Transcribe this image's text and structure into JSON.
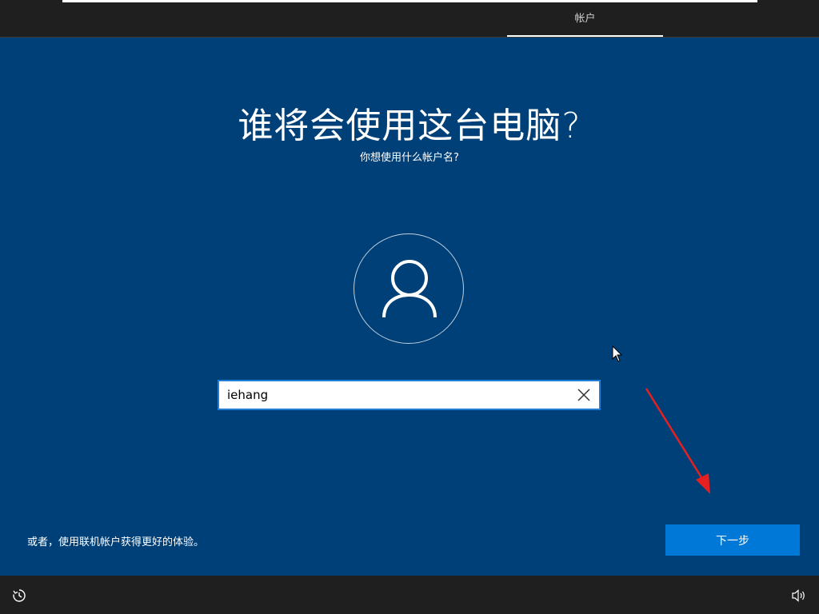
{
  "header": {
    "active_tab": "帐户"
  },
  "main": {
    "title": "谁将会使用这台电脑?",
    "subtitle": "你想使用什么帐户名?",
    "name_input": {
      "value": "iehang",
      "placeholder": ""
    },
    "online_account_link": "或者，使用联机帐户获得更好的体验。",
    "next_button_label": "下一步"
  },
  "icons": {
    "avatar": "user-icon",
    "clear": "close-icon",
    "ease_of_access": "ease-of-access-icon",
    "volume": "volume-icon",
    "mouse_cursor": "mouse-pointer-icon",
    "annotation": "red-arrow-icon"
  },
  "colors": {
    "background_blue": "#004078",
    "accent_blue": "#0078d7",
    "input_border": "#1f7fd6",
    "bar_dark": "#1f1f1f",
    "annotation_red": "#e62020"
  }
}
